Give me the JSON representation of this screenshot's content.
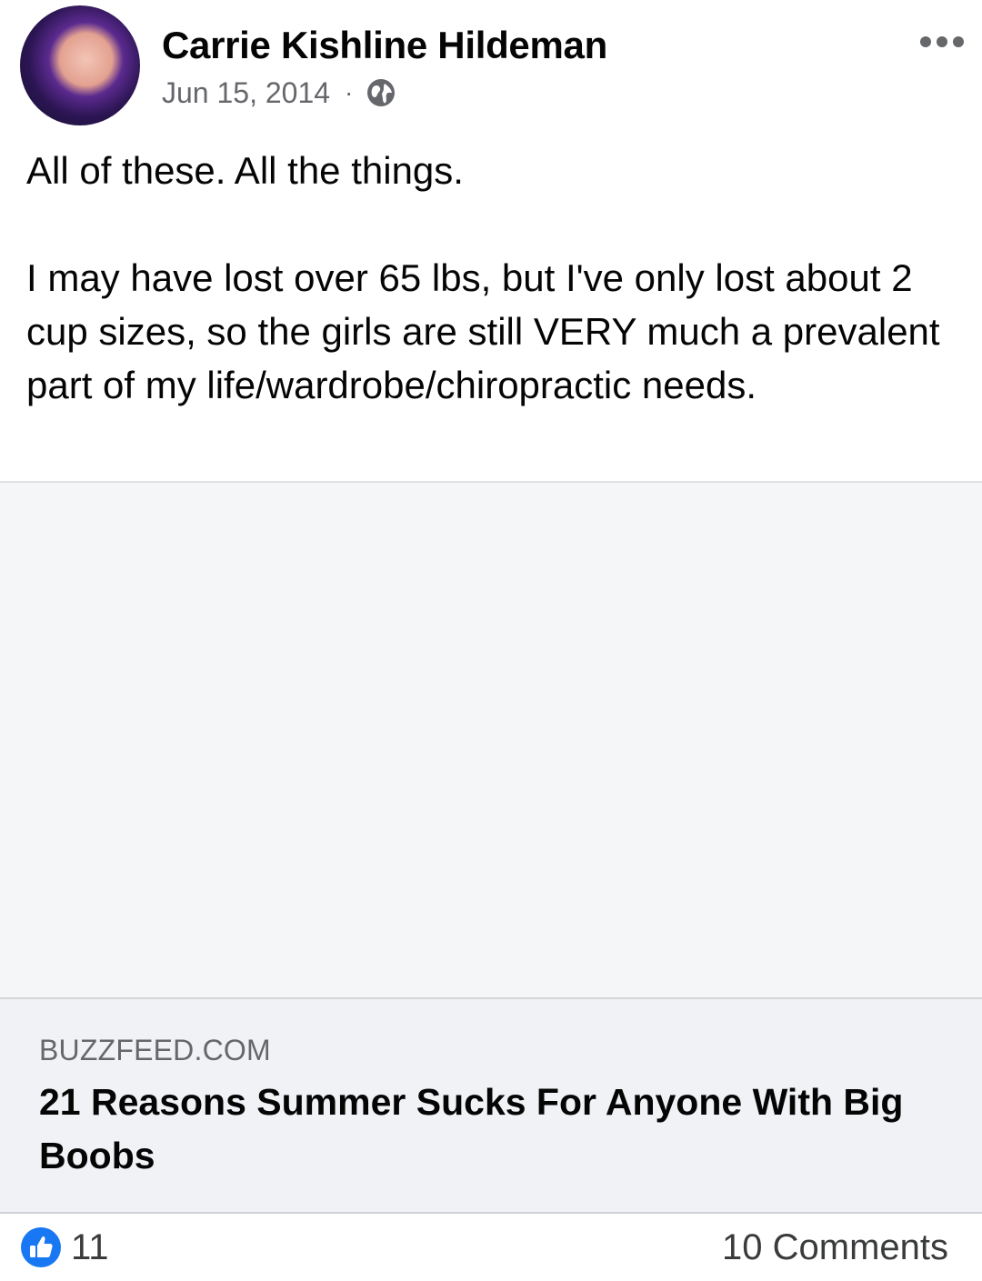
{
  "post": {
    "author": "Carrie Kishline Hildeman",
    "date": "Jun 15, 2014",
    "separator": "·",
    "privacy_icon": "globe-icon",
    "more_icon": "more-horizontal-icon",
    "text_line1": "All of these. All the things.",
    "text_paragraph2": "I may have lost over 65 lbs, but I've only lost about 2 cup sizes, so the girls are still VERY much a prevalent part of my life/wardrobe/chiropractic needs."
  },
  "link": {
    "domain": "BUZZFEED.COM",
    "title": "21 Reasons Summer Sucks For Anyone With Big Boobs"
  },
  "footer": {
    "reaction_icon": "like-icon",
    "like_count": "11",
    "comments": "10 Comments"
  },
  "colors": {
    "like_blue": "#1877f2",
    "secondary_text": "#65676b",
    "link_bg": "#f0f2f5",
    "image_placeholder_bg": "#f5f6f8"
  }
}
